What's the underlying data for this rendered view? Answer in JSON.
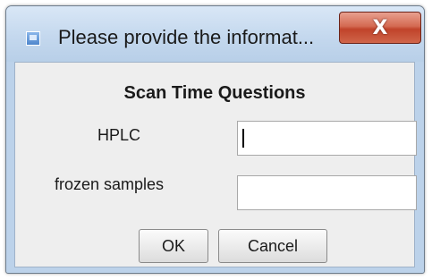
{
  "window": {
    "title": "Please provide the informat...",
    "close_label": "X"
  },
  "dialog": {
    "heading": "Scan Time Questions",
    "fields": [
      {
        "label": "HPLC",
        "value": ""
      },
      {
        "label": "frozen samples",
        "value": ""
      }
    ],
    "ok_label": "OK",
    "cancel_label": "Cancel"
  },
  "icons": {
    "app": "java-app-icon",
    "close": "close-icon"
  }
}
